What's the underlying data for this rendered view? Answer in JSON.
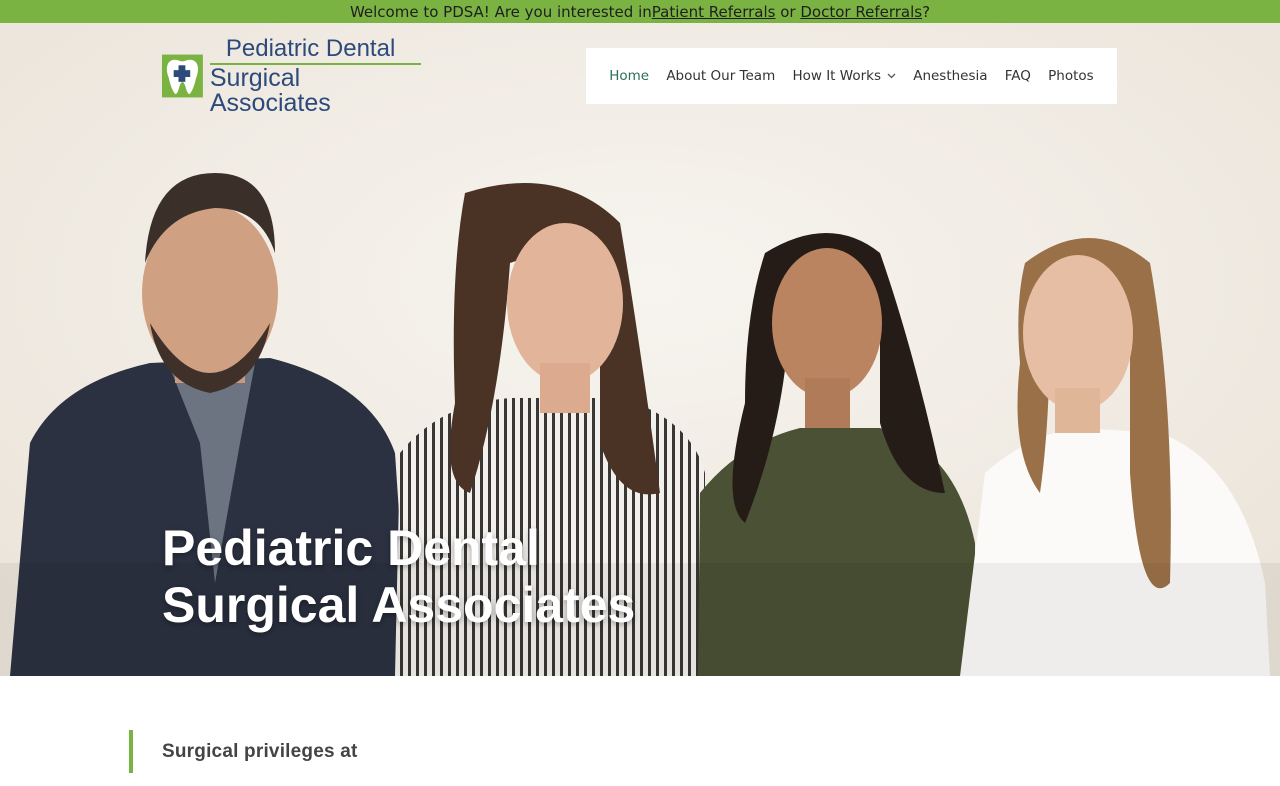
{
  "banner": {
    "text_before": "Welcome to PDSA! Are you interested in ",
    "link_patient": "Patient Referrals",
    "text_mid": " or ",
    "link_doctor": "Doctor Referrals",
    "text_after": "?"
  },
  "logo": {
    "line1": "Pediatric Dental",
    "line2": "Surgical Associates",
    "icon": "tooth-cross-icon"
  },
  "nav": {
    "items": [
      {
        "label": "Home",
        "active": true
      },
      {
        "label": "About Our Team"
      },
      {
        "label": "How It Works",
        "has_dropdown": true
      },
      {
        "label": "Anesthesia"
      },
      {
        "label": "FAQ"
      },
      {
        "label": "Photos"
      }
    ]
  },
  "hero": {
    "title_line1": "Pediatric Dental",
    "title_line2": "Surgical Associates"
  },
  "section": {
    "heading": "Surgical privileges at"
  },
  "colors": {
    "accent_green": "#7bb342",
    "logo_blue": "#2c4a7a",
    "nav_active": "#2e6f57"
  }
}
